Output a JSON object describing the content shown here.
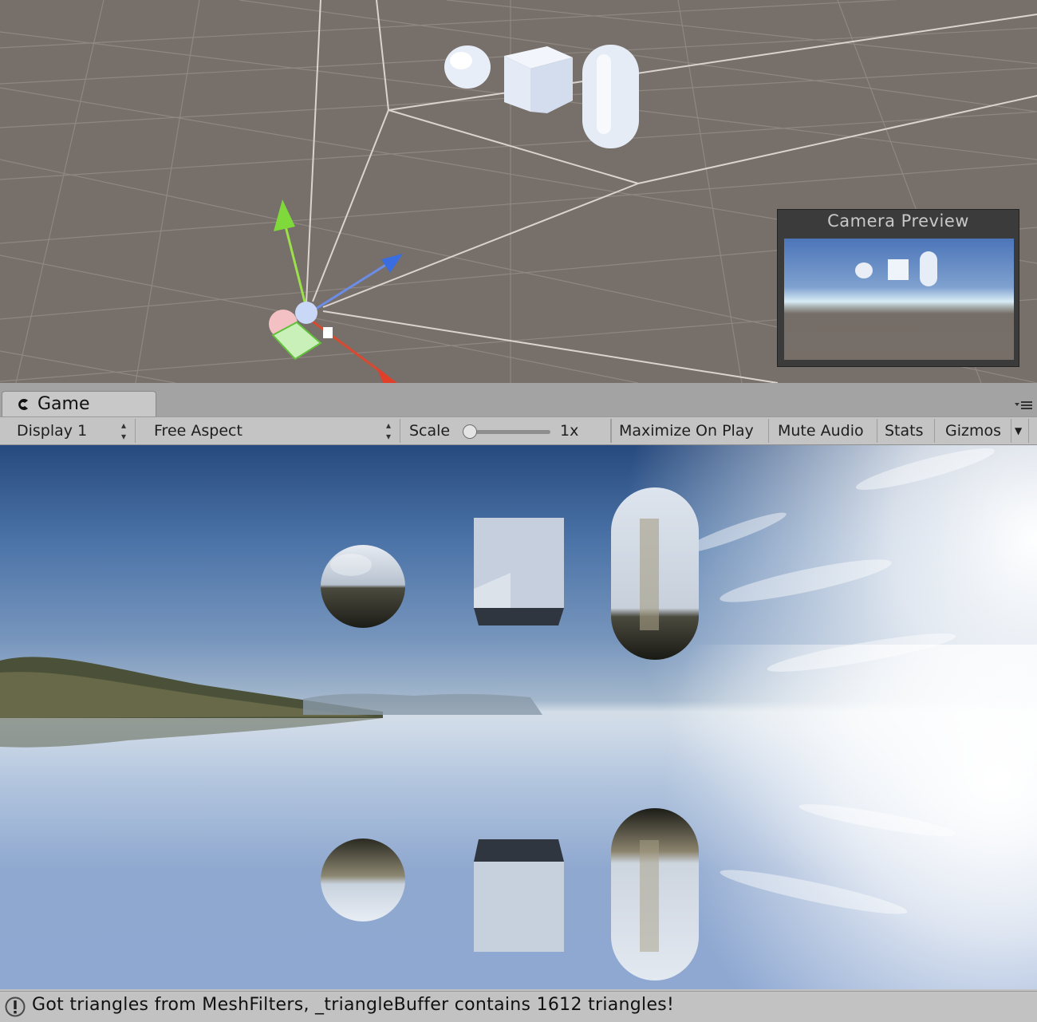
{
  "scene_view": {
    "camera_preview": {
      "title": "Camera Preview"
    }
  },
  "game_tab": {
    "label": "Game",
    "icon": "unity-game-icon"
  },
  "toolbar": {
    "display": "Display 1",
    "aspect": "Free Aspect",
    "scale_label": "Scale",
    "scale_value": "1x",
    "maximize_on_play": "Maximize On Play",
    "mute_audio": "Mute Audio",
    "stats": "Stats",
    "gizmos": "Gizmos"
  },
  "status": {
    "icon": "warning-icon",
    "message": "Got triangles from MeshFilters, _triangleBuffer contains 1612 triangles!"
  },
  "colors": {
    "scene_bg": "#776f69",
    "grid": "#958d87",
    "gizmo_y": "#7fd93a",
    "gizmo_z": "#3a6de0",
    "gizmo_x": "#e0402a"
  }
}
